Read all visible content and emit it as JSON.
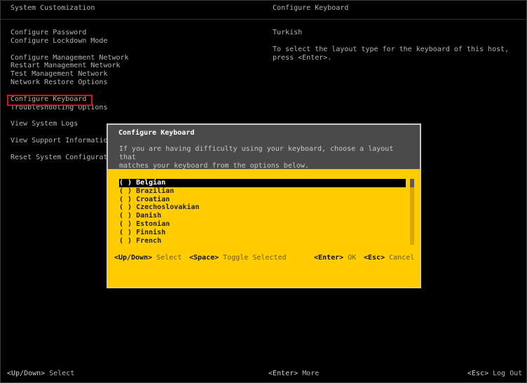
{
  "header": {
    "left_title": "System Customization",
    "right_title": "Configure Keyboard"
  },
  "menu": {
    "groups": [
      [
        "Configure Password",
        "Configure Lockdown Mode"
      ],
      [
        "Configure Management Network",
        "Restart Management Network",
        "Test Management Network",
        "Network Restore Options"
      ],
      [
        "Configure Keyboard",
        "Troubleshooting Options"
      ],
      [
        "View System Logs"
      ],
      [
        "View Support Information"
      ],
      [
        "Reset System Configuration"
      ]
    ],
    "selected": "Configure Keyboard"
  },
  "right_panel": {
    "current_value": "Turkish",
    "description": "To select the layout type for the keyboard of this host,\npress <Enter>."
  },
  "footer": {
    "left_key": "<Up/Down>",
    "left_text": "Select",
    "mid_key": "<Enter>",
    "mid_text": "More",
    "right_key": "<Esc>",
    "right_text": "Log Out"
  },
  "dialog": {
    "title": "Configure Keyboard",
    "help": "If you are having difficulty using your keyboard, choose a layout that\nmatches your keyboard from the options below.",
    "options": [
      {
        "label": "( ) Belgian",
        "selected": true
      },
      {
        "label": "( ) Brazilian",
        "selected": false
      },
      {
        "label": "( ) Croatian",
        "selected": false
      },
      {
        "label": "( ) Czechoslovakian",
        "selected": false
      },
      {
        "label": "( ) Danish",
        "selected": false
      },
      {
        "label": "( ) Estonian",
        "selected": false
      },
      {
        "label": "( ) Finnish",
        "selected": false
      },
      {
        "label": "( ) French",
        "selected": false
      }
    ],
    "footer": {
      "updown_key": "<Up/Down>",
      "updown_text": "Select",
      "space_key": "<Space>",
      "space_text": "Toggle Selected",
      "enter_key": "<Enter>",
      "enter_text": "OK",
      "esc_key": "<Esc>",
      "esc_text": "Cancel"
    }
  },
  "colors": {
    "background": "#000000",
    "text": "#b5b5b5",
    "dialog_yellow": "#ffcc00",
    "dialog_header": "#4a4a4a",
    "highlight_red": "#e01010"
  }
}
